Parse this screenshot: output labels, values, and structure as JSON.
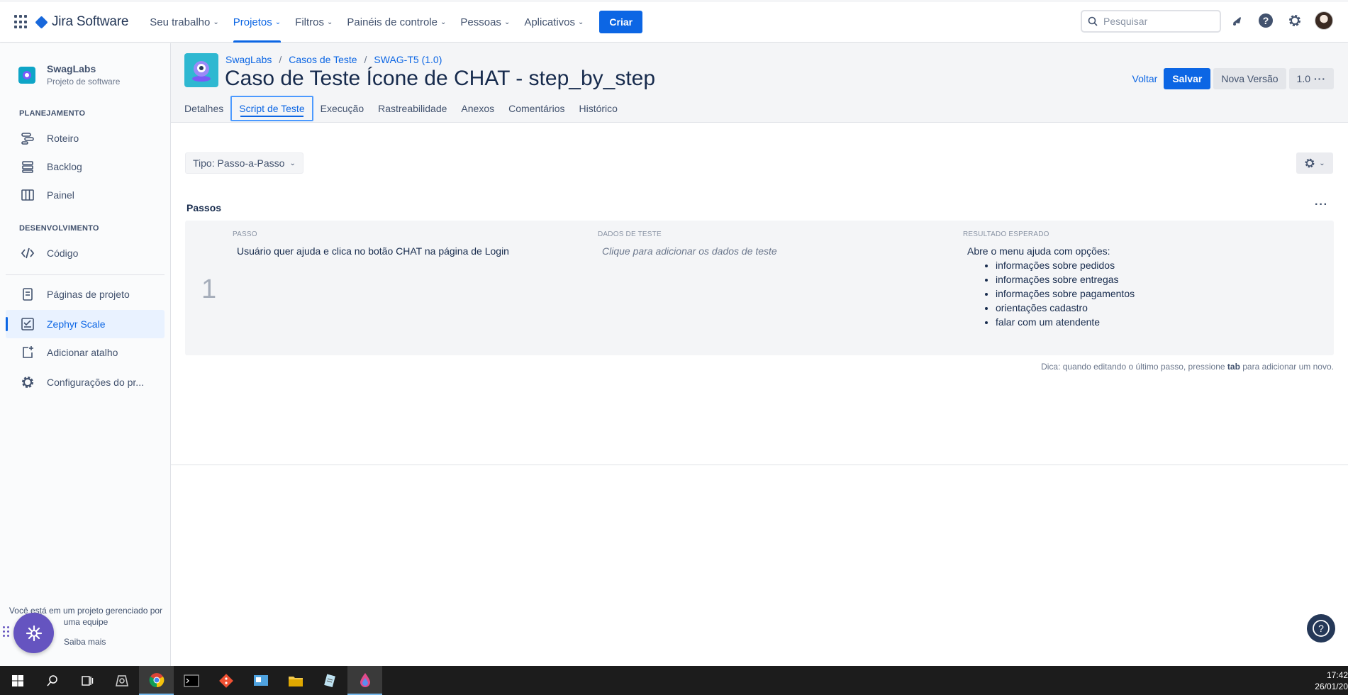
{
  "topnav": {
    "app_name": "Jira Software",
    "items": [
      {
        "label": "Seu trabalho"
      },
      {
        "label": "Projetos"
      },
      {
        "label": "Filtros"
      },
      {
        "label": "Painéis de controle"
      },
      {
        "label": "Pessoas"
      },
      {
        "label": "Aplicativos"
      }
    ],
    "active_item": "Projetos",
    "create_label": "Criar",
    "search_placeholder": "Pesquisar"
  },
  "sidebar": {
    "project_name": "SwagLabs",
    "project_type": "Projeto de software",
    "planning_title": "PLANEJAMENTO",
    "planning_items": [
      {
        "label": "Roteiro",
        "icon": "roadmap-icon"
      },
      {
        "label": "Backlog",
        "icon": "backlog-icon"
      },
      {
        "label": "Painel",
        "icon": "board-icon"
      }
    ],
    "dev_title": "DESENVOLVIMENTO",
    "dev_items": [
      {
        "label": "Código",
        "icon": "code-icon"
      }
    ],
    "other_items": [
      {
        "label": "Páginas de projeto",
        "icon": "page-icon"
      },
      {
        "label": "Zephyr Scale",
        "icon": "zephyr-icon",
        "selected": true
      },
      {
        "label": "Adicionar atalho",
        "icon": "add-shortcut-icon"
      },
      {
        "label": "Configurações do pr...",
        "icon": "settings-icon"
      }
    ],
    "managed_text": "Você está em um projeto gerenciado por uma equipe",
    "learn_more": "Saiba mais"
  },
  "header": {
    "breadcrumbs": [
      "SwagLabs",
      "Casos de Teste",
      "SWAG-T5 (1.0)"
    ],
    "title": "Caso de Teste Ícone de CHAT - step_by_step",
    "back_label": "Voltar",
    "save_label": "Salvar",
    "new_version_label": "Nova Versão",
    "version_label": "1.0",
    "tabs": [
      {
        "label": "Detalhes"
      },
      {
        "label": "Script de Teste"
      },
      {
        "label": "Execução"
      },
      {
        "label": "Rastreabilidade"
      },
      {
        "label": "Anexos"
      },
      {
        "label": "Comentários"
      },
      {
        "label": "Histórico"
      }
    ],
    "active_tab": "Script de Teste"
  },
  "script": {
    "type_label": "Tipo: Passo-a-Passo",
    "steps_title": "Passos",
    "columns": {
      "step": "PASSO",
      "data": "DADOS DE TESTE",
      "result": "RESULTADO ESPERADO"
    },
    "steps": [
      {
        "number": "1",
        "step": "Usuário quer ajuda e clica no botão CHAT na página de Login",
        "data_placeholder": "Clique para adicionar os dados de teste",
        "result_intro": "Abre o menu ajuda com opções:",
        "result_items": [
          "informações sobre pedidos",
          "informações sobre entregas",
          "informações sobre pagamentos",
          "orientações cadastro",
          "falar com um atendente"
        ]
      }
    ],
    "hint_prefix": "Dica: quando editando o último passo, pressione",
    "hint_key": "tab",
    "hint_suffix": "para adicionar um novo."
  },
  "taskbar": {
    "time": "17:42",
    "date": "26/01/20"
  },
  "colors": {
    "accent": "#0c66e4",
    "zephyr": "#2fb8d1",
    "fab": "#6554c0"
  }
}
